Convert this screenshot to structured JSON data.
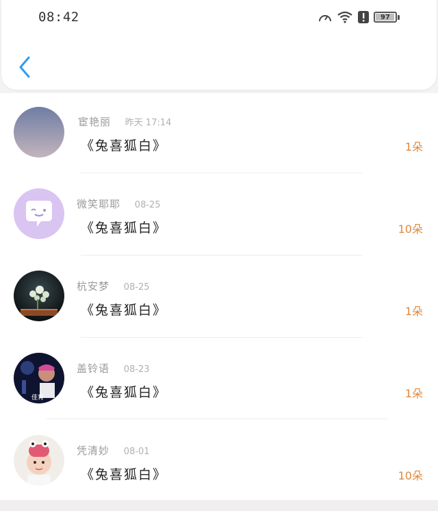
{
  "status_bar": {
    "time": "08:42",
    "battery_level": 97,
    "battery_text": "97",
    "icons": [
      "speedometer-icon",
      "wifi-icon",
      "alert-icon",
      "battery-icon"
    ]
  },
  "header": {
    "back_icon": "chevron-left-icon",
    "accent_color": "#2e9bf0"
  },
  "items": [
    {
      "name": "宦艳丽",
      "date": "昨天 17:14",
      "title": "《兔喜狐白》",
      "count": "1朵"
    },
    {
      "name": "微笑耶耶",
      "date": "08-25",
      "title": "《兔喜狐白》",
      "count": "10朵"
    },
    {
      "name": "杭安梦",
      "date": "08-25",
      "title": "《兔喜狐白》",
      "count": "1朵"
    },
    {
      "name": "盖铃语",
      "date": "08-23",
      "title": "《兔喜狐白》",
      "count": "1朵"
    },
    {
      "name": "凭清妙",
      "date": "08-01",
      "title": "《兔喜狐白》",
      "count": "10朵"
    }
  ],
  "avatar_overlay_text": "佳育",
  "colors": {
    "count": "#e1873c",
    "meta": "#9a9a9a",
    "title": "#222222"
  }
}
